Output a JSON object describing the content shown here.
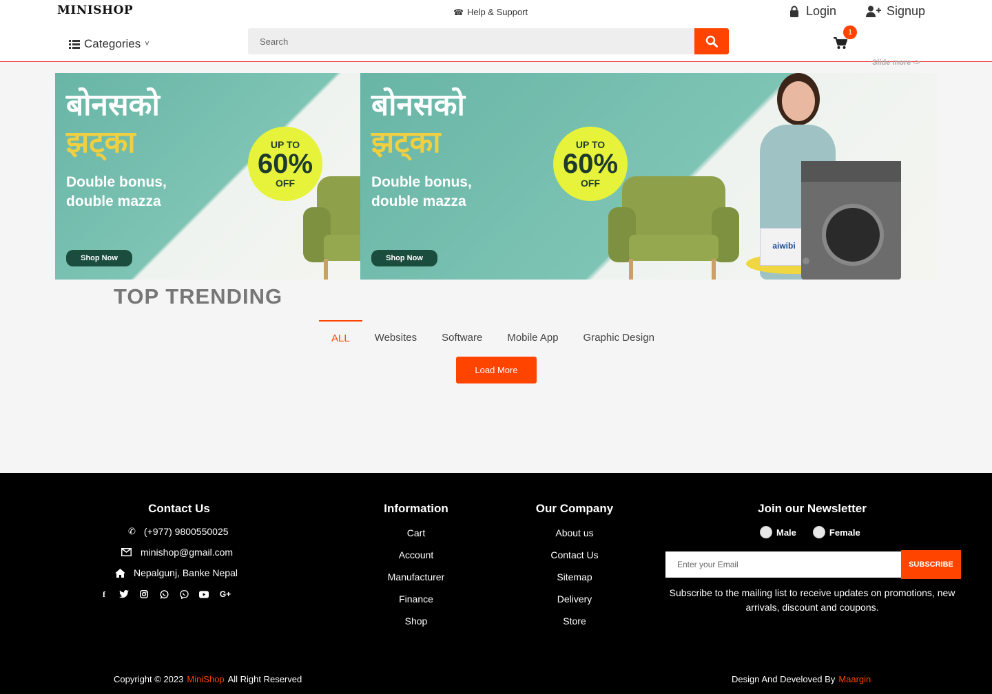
{
  "header": {
    "logo": "MINISHOP",
    "help": "Help & Support",
    "login": "Login",
    "signup": "Signup",
    "categories": "Categories",
    "search_placeholder": "Search",
    "cart_count": "1",
    "slide_more": "Slide more ->"
  },
  "banner": {
    "title_line1": "बोनसको",
    "title_line2": "झट्का",
    "subtitle_line1": "Double bonus,",
    "subtitle_line2": "double mazza",
    "badge_top": "UP TO",
    "badge_pct": "60%",
    "badge_bottom": "OFF",
    "cta": "Shop Now",
    "box_brand": "aiwibi"
  },
  "trending": {
    "title": "TOP TRENDING",
    "tabs": [
      "ALL",
      "Websites",
      "Software",
      "Mobile App",
      "Graphic Design"
    ],
    "load_more": "Load More"
  },
  "footer": {
    "contact": {
      "heading": "Contact Us",
      "phone": "(+977) 9800550025",
      "email": "minishop@gmail.com",
      "address": "Nepalgunj, Banke Nepal"
    },
    "information": {
      "heading": "Information",
      "links": [
        "Cart",
        "Account",
        "Manufacturer",
        "Finance",
        "Shop"
      ]
    },
    "company": {
      "heading": "Our Company",
      "links": [
        "About us",
        "Contact Us",
        "Sitemap",
        "Delivery",
        "Store"
      ]
    },
    "newsletter": {
      "heading": "Join our Newsletter",
      "male": "Male",
      "female": "Female",
      "placeholder": "Enter your Email",
      "button": "SUBSCRIBE",
      "text": "Subscribe to the mailing list to receive updates on promotions, new arrivals, discount and coupons."
    },
    "copyright_prefix": "Copyright © 2023",
    "copyright_brand": "MiniShop",
    "copyright_suffix": "All Right Reserved",
    "credit_prefix": "Design And Develoved By",
    "credit_brand": "Maargin"
  },
  "colors": {
    "accent": "#ff4400",
    "footer_bg": "#000000",
    "page_bg": "#f5f5f5"
  }
}
